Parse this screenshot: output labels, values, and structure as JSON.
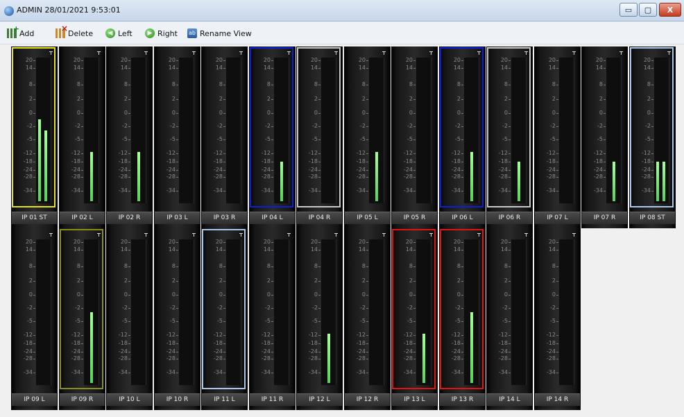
{
  "window": {
    "title": "ADMIN  28/01/2021 9:53:01",
    "buttons": {
      "minimize": "▭",
      "maximize": "▢",
      "close": "X"
    }
  },
  "toolbar": [
    {
      "label": "Add",
      "icon": "add-icon"
    },
    {
      "label": "Delete",
      "icon": "delete-icon"
    },
    {
      "label": "Left",
      "icon": "arrow-left-icon"
    },
    {
      "label": "Right",
      "icon": "arrow-right-icon"
    },
    {
      "label": "Rename View",
      "icon": "rename-icon"
    }
  ],
  "scale": [
    "20",
    "14",
    "8",
    "2",
    "0",
    "-2",
    "-5",
    "-12",
    "-18",
    "-24",
    "-28",
    "-34"
  ],
  "border_colors": {
    "yellow": "#e6e20d",
    "blue": "#0b1fd6",
    "gray": "#c8c8c8",
    "lightblue": "#a8c8ec",
    "olive": "#8a8f12",
    "red": "#e21212"
  },
  "meters": [
    {
      "label": "IP 01 ST",
      "border": "yellow",
      "levels": [
        0.58,
        0.5
      ]
    },
    {
      "label": "IP 02 L",
      "border": "",
      "levels": [
        0.35
      ]
    },
    {
      "label": "IP 02 R",
      "border": "",
      "levels": [
        0.35
      ]
    },
    {
      "label": "IP 03 L",
      "border": "",
      "levels": [
        0
      ]
    },
    {
      "label": "IP 03 R",
      "border": "",
      "levels": [
        0
      ]
    },
    {
      "label": "IP 04 L",
      "border": "blue",
      "levels": [
        0.28
      ]
    },
    {
      "label": "IP 04 R",
      "border": "gray",
      "levels": [
        0
      ]
    },
    {
      "label": "IP 05 L",
      "border": "",
      "levels": [
        0.35
      ]
    },
    {
      "label": "IP 05 R",
      "border": "",
      "levels": [
        0
      ]
    },
    {
      "label": "IP 06 L",
      "border": "blue",
      "levels": [
        0.35
      ]
    },
    {
      "label": "IP 06 R",
      "border": "gray",
      "levels": [
        0.28
      ]
    },
    {
      "label": "IP 07 L",
      "border": "",
      "levels": [
        0
      ]
    },
    {
      "label": "IP 07 R",
      "border": "",
      "levels": [
        0.28
      ]
    },
    {
      "label": "IP 08 ST",
      "border": "lightblue",
      "levels": [
        0.28,
        0.28
      ]
    },
    {
      "label": "IP 09 L",
      "border": "",
      "levels": [
        0
      ]
    },
    {
      "label": "IP 09 R",
      "border": "olive",
      "levels": [
        0.5
      ]
    },
    {
      "label": "IP 10 L",
      "border": "",
      "levels": [
        0
      ]
    },
    {
      "label": "IP 10 R",
      "border": "",
      "levels": [
        0
      ]
    },
    {
      "label": "IP 11 L",
      "border": "lightblue",
      "levels": [
        0
      ]
    },
    {
      "label": "IP 11 R",
      "border": "",
      "levels": [
        0
      ]
    },
    {
      "label": "IP 12 L",
      "border": "",
      "levels": [
        0.35
      ]
    },
    {
      "label": "IP 12 R",
      "border": "",
      "levels": [
        0
      ]
    },
    {
      "label": "IP 13 L",
      "border": "red",
      "levels": [
        0.35
      ]
    },
    {
      "label": "IP 13 R",
      "border": "red",
      "levels": [
        0.5
      ]
    },
    {
      "label": "IP 14 L",
      "border": "",
      "levels": [
        0
      ]
    },
    {
      "label": "IP 14 R",
      "border": "",
      "levels": [
        0
      ]
    }
  ]
}
